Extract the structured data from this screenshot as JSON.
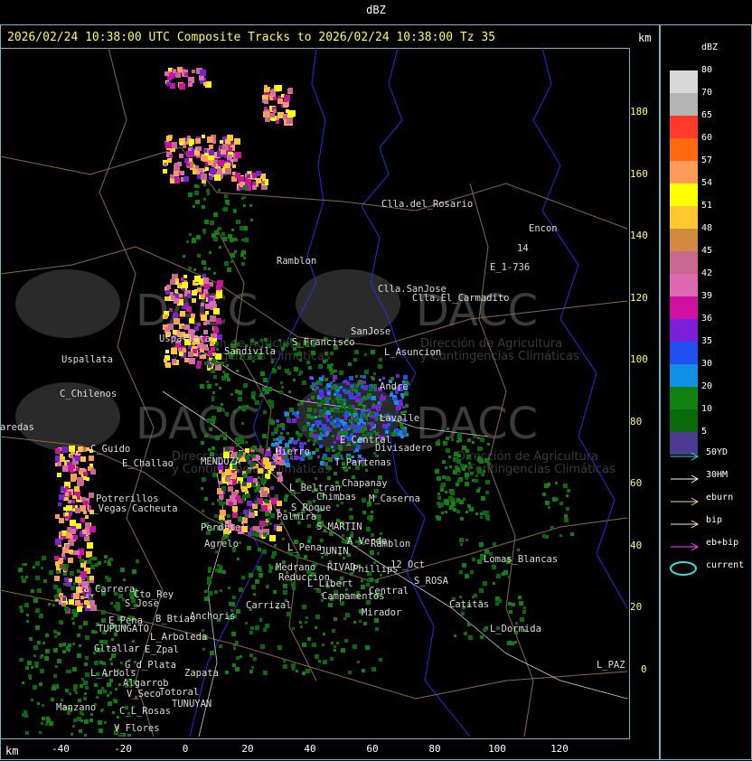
{
  "window": {
    "title": "dBZ"
  },
  "header": {
    "line": "2026/02/24 10:38:00 UTC Composite Tracks to 2026/02/24 10:38:00 Tz 35",
    "km_label": "km"
  },
  "axes": {
    "km_label": "km",
    "y_ticks": [
      "180",
      "160",
      "140",
      "120",
      "100",
      "80",
      "60",
      "40",
      "20",
      "0"
    ],
    "x_ticks": [
      "-40",
      "-20",
      "0",
      "20",
      "40",
      "60",
      "80",
      "100",
      "120"
    ]
  },
  "legend": {
    "title": "dBZ",
    "levels": [
      {
        "label": "80",
        "color": "#d8d8d8"
      },
      {
        "label": "70",
        "color": "#b4b4b4"
      },
      {
        "label": "65",
        "color": "#ff3a2a"
      },
      {
        "label": "60",
        "color": "#ff6a10"
      },
      {
        "label": "57",
        "color": "#ff9a58"
      },
      {
        "label": "54",
        "color": "#ffff00"
      },
      {
        "label": "51",
        "color": "#ffc830"
      },
      {
        "label": "48",
        "color": "#d28a40"
      },
      {
        "label": "45",
        "color": "#c86890"
      },
      {
        "label": "42",
        "color": "#dd6ab0"
      },
      {
        "label": "39",
        "color": "#d010a0"
      },
      {
        "label": "36",
        "color": "#7a20d8"
      },
      {
        "label": "35",
        "color": "#2050f0"
      },
      {
        "label": "30",
        "color": "#1090e0"
      },
      {
        "label": "20",
        "color": "#108010"
      },
      {
        "label": "10",
        "color": "#0a6a0a"
      },
      {
        "label": "5",
        "color": "#4a3a90"
      }
    ],
    "tracks": [
      {
        "label": "50YD",
        "color": "#30e0e0"
      },
      {
        "label": "30HM",
        "color": "#ffffff"
      },
      {
        "label": "eburn",
        "color": "#ffcc88"
      },
      {
        "label": "bip",
        "color": "#ffd8e8"
      },
      {
        "label": "eb+bip",
        "color": "#ff40ff"
      },
      {
        "label": "current",
        "color": "#30e0e0"
      }
    ]
  },
  "places": [
    {
      "name": "Clla.del_Rosario"
    },
    {
      "name": "Encon"
    },
    {
      "name": "142"
    },
    {
      "name": "E_1-736"
    },
    {
      "name": "Ramblon"
    },
    {
      "name": "Clla.SanJose"
    },
    {
      "name": "Clla.El_Carmadito"
    },
    {
      "name": "SanJose"
    },
    {
      "name": "S_Francisco"
    },
    {
      "name": "L_Asuncion"
    },
    {
      "name": "Uspallata"
    },
    {
      "name": "C_Chilenos"
    },
    {
      "name": "Sandivila"
    },
    {
      "name": "Uspallata2"
    },
    {
      "name": "Andre"
    },
    {
      "name": "Lavalle"
    },
    {
      "name": "Divisadero"
    },
    {
      "name": "E_Central"
    },
    {
      "name": "Hierro"
    },
    {
      "name": "C_Guido"
    },
    {
      "name": "E_Challao"
    },
    {
      "name": "MENDOZA"
    },
    {
      "name": "T_Partenas"
    },
    {
      "name": "Chapanay"
    },
    {
      "name": "L_Beltran"
    },
    {
      "name": "Chimbas"
    },
    {
      "name": "M_Caserna"
    },
    {
      "name": "Potrerillos"
    },
    {
      "name": "L_Vegas"
    },
    {
      "name": "Cacheuta"
    },
    {
      "name": "Perdriel"
    },
    {
      "name": "S_Roque"
    },
    {
      "name": "Palmira"
    },
    {
      "name": "S_MARTIN"
    },
    {
      "name": "A_Verde"
    },
    {
      "name": "Agrelo"
    },
    {
      "name": "L_Pena"
    },
    {
      "name": "JUNIN"
    },
    {
      "name": "Ramblon2"
    },
    {
      "name": "Lomas_Blancas"
    },
    {
      "name": "12_Oct"
    },
    {
      "name": "RIVAD"
    },
    {
      "name": "Phillips"
    },
    {
      "name": "Medrano"
    },
    {
      "name": "Reduccion"
    },
    {
      "name": "S_ROSA"
    },
    {
      "name": "L_Libert"
    },
    {
      "name": "Central"
    },
    {
      "name": "Catitas"
    },
    {
      "name": "Campamentos"
    },
    {
      "name": "La_Carrera"
    },
    {
      "name": "Cto_Rey"
    },
    {
      "name": "S_Jose"
    },
    {
      "name": "Carrizal"
    },
    {
      "name": "Anchoris"
    },
    {
      "name": "E_Pena"
    },
    {
      "name": "B_Btias"
    },
    {
      "name": "TUPUNGATO"
    },
    {
      "name": "Mirador"
    },
    {
      "name": "L_Dormida"
    },
    {
      "name": "L_Arboleda"
    },
    {
      "name": "Gltallar"
    },
    {
      "name": "E_Zpal"
    },
    {
      "name": "G_d_Plata"
    },
    {
      "name": "L_Arbols"
    },
    {
      "name": "Zapata"
    },
    {
      "name": "Algarrob"
    },
    {
      "name": "V_Seco"
    },
    {
      "name": "Totoral"
    },
    {
      "name": "TUNUYAN"
    },
    {
      "name": "Manzano"
    },
    {
      "name": "C_L_Rosas"
    },
    {
      "name": "V_Flores"
    },
    {
      "name": "L_PAZ"
    },
    {
      "name": "aredas"
    }
  ],
  "watermark": {
    "brand": "DACC",
    "line1": "Dirección de Agricultura",
    "line2": "y Contingencias Climáticas"
  }
}
